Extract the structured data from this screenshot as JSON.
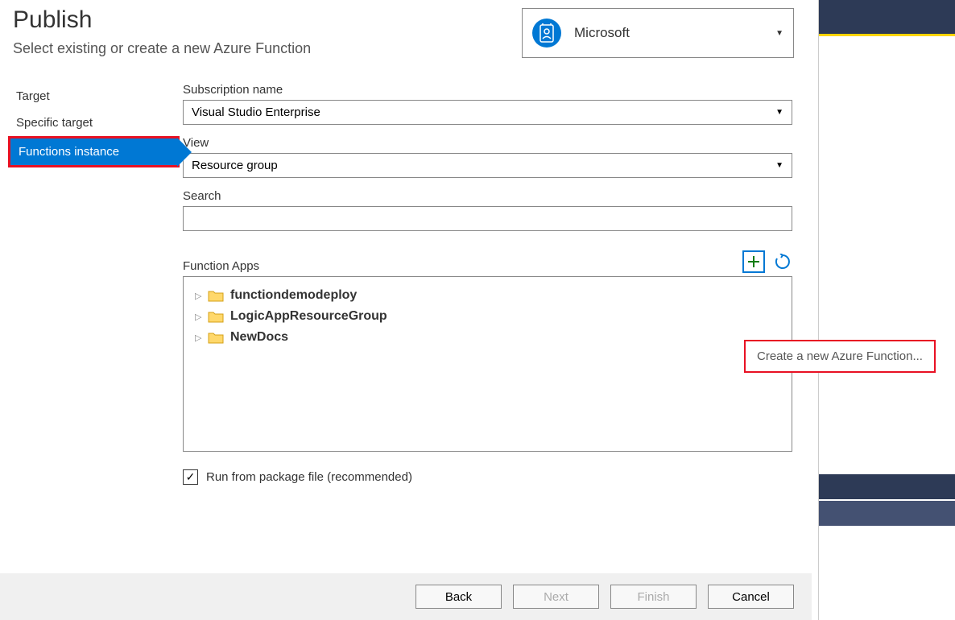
{
  "header": {
    "title": "Publish",
    "subtitle": "Select existing or create a new Azure Function"
  },
  "account": {
    "name": "Microsoft"
  },
  "nav": {
    "items": [
      {
        "label": "Target",
        "selected": false
      },
      {
        "label": "Specific target",
        "selected": false
      },
      {
        "label": "Functions instance",
        "selected": true
      }
    ]
  },
  "form": {
    "subscription_label": "Subscription name",
    "subscription_value": "Visual Studio Enterprise",
    "view_label": "View",
    "view_value": "Resource group",
    "search_label": "Search",
    "search_value": "",
    "function_apps_label": "Function Apps",
    "tree_items": [
      {
        "label": "functiondemodeploy"
      },
      {
        "label": "LogicAppResourceGroup"
      },
      {
        "label": "NewDocs"
      }
    ],
    "run_from_package_label": "Run from package file (recommended)",
    "run_from_package_checked": true
  },
  "tooltip": {
    "text": "Create a new Azure Function..."
  },
  "footer": {
    "back": "Back",
    "next": "Next",
    "finish": "Finish",
    "cancel": "Cancel"
  }
}
